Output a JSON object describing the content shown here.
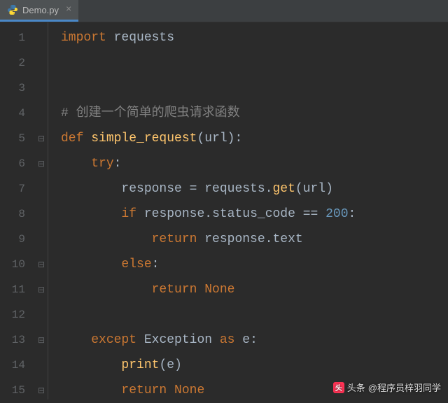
{
  "tab": {
    "filename": "Demo.py",
    "close_glyph": "×"
  },
  "gutter": {
    "lines": [
      "1",
      "2",
      "3",
      "4",
      "5",
      "6",
      "7",
      "8",
      "9",
      "10",
      "11",
      "12",
      "13",
      "14",
      "15"
    ]
  },
  "fold_markers": {
    "l5": "⊟",
    "l6": "⊟",
    "l10": "⊟",
    "l11": "⊟",
    "l13": "⊟",
    "l15": "⊟"
  },
  "code": {
    "l1": {
      "kw": "import",
      "sp": " ",
      "id": "requests"
    },
    "l4": {
      "cmt": "# 创建一个简单的爬虫请求函数"
    },
    "l5": {
      "kw": "def",
      "sp": " ",
      "fn": "simple_request",
      "op1": "(",
      "id": "url",
      "op2": "):"
    },
    "l6": {
      "indent": "    ",
      "kw": "try",
      "op": ":"
    },
    "l7": {
      "indent": "        ",
      "id1": "response",
      "op1": " = ",
      "id2": "requests",
      "op2": ".",
      "fn": "get",
      "op3": "(",
      "id3": "url",
      "op4": ")"
    },
    "l8": {
      "indent": "        ",
      "kw": "if",
      "sp": " ",
      "id1": "response",
      "op1": ".",
      "id2": "status_code",
      "op2": " == ",
      "num": "200",
      "op3": ":"
    },
    "l9": {
      "indent": "            ",
      "kw": "return",
      "sp": " ",
      "id1": "response",
      "op1": ".",
      "id2": "text"
    },
    "l10": {
      "indent": "        ",
      "kw": "else",
      "op": ":"
    },
    "l11": {
      "indent": "            ",
      "kw": "return",
      "sp": " ",
      "none": "None"
    },
    "l13": {
      "indent": "    ",
      "kw": "except",
      "sp": " ",
      "id1": "Exception",
      "kw2": "as",
      "sp2": " ",
      "id2": "e",
      "op": ":"
    },
    "l14": {
      "indent": "        ",
      "fn": "print",
      "op1": "(",
      "id": "e",
      "op2": ")"
    },
    "l15": {
      "indent": "        ",
      "kw": "return",
      "sp": " ",
      "none": "None"
    }
  },
  "watermark": {
    "prefix": "头条",
    "handle": "@程序员梓羽同学"
  }
}
